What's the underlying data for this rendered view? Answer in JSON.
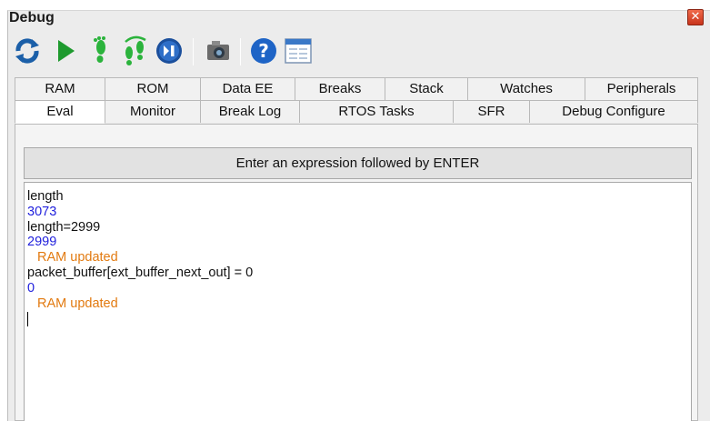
{
  "window": {
    "title": "Debug",
    "close_icon": "close-icon"
  },
  "toolbar": {
    "items": [
      {
        "icon": "refresh-icon",
        "label": "Reset"
      },
      {
        "icon": "play-icon",
        "label": "Run"
      },
      {
        "icon": "step-into-icon",
        "label": "Step Into"
      },
      {
        "icon": "step-over-icon",
        "label": "Step Over"
      },
      {
        "icon": "step-out-icon",
        "label": "Step Out"
      },
      {
        "icon": "camera-icon",
        "label": "Snapshot"
      },
      {
        "icon": "help-icon",
        "label": "Help"
      },
      {
        "icon": "window-icon",
        "label": "Window"
      }
    ]
  },
  "tabs": {
    "row1": [
      "RAM",
      "ROM",
      "Data EE",
      "Breaks",
      "Stack",
      "Watches",
      "Peripherals"
    ],
    "row2": [
      "Eval",
      "Monitor",
      "Break Log",
      "RTOS Tasks",
      "SFR",
      "Debug Configure"
    ],
    "active": "Eval"
  },
  "eval": {
    "header": "Enter an expression followed by ENTER",
    "lines": [
      {
        "type": "input",
        "text": "length"
      },
      {
        "type": "result",
        "text": "3073"
      },
      {
        "type": "input",
        "text": "length=2999"
      },
      {
        "type": "result",
        "text": "2999"
      },
      {
        "type": "status",
        "text": "RAM updated"
      },
      {
        "type": "input",
        "text": "packet_buffer[ext_buffer_next_out] = 0"
      },
      {
        "type": "result",
        "text": "0"
      },
      {
        "type": "status",
        "text": "RAM updated"
      }
    ]
  },
  "colors": {
    "input_text": "#111111",
    "result_text": "#2222dd",
    "status_text": "#e27a10",
    "close_button": "#d9452b"
  }
}
